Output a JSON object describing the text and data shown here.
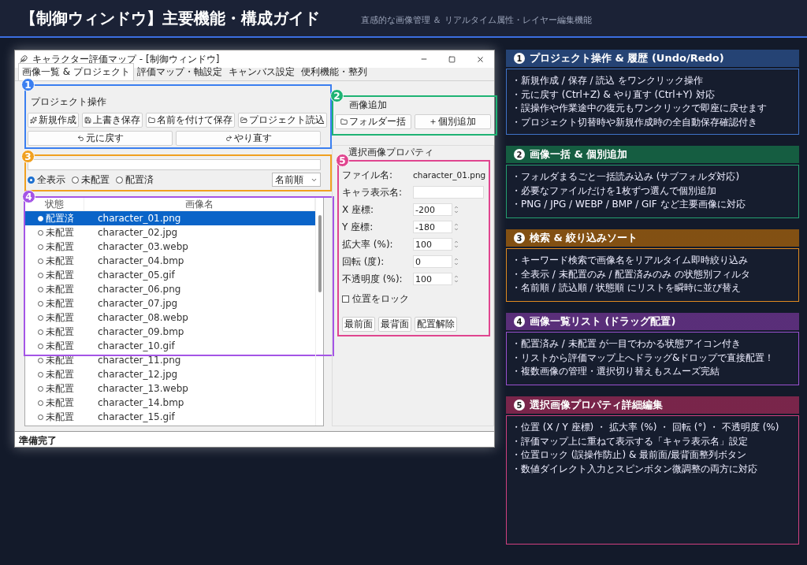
{
  "header": {
    "title": "【制御ウィンドウ】主要機能・構成ガイド",
    "subtitle": "直感的な画像管理 ＆ リアルタイム属性・レイヤー編集機能"
  },
  "window": {
    "title": "キャラクター評価マップ - [制御ウィンドウ]",
    "tabs": [
      {
        "label": "画像一覧 & プロジェクト",
        "selected": true
      },
      {
        "label": "評価マップ・軸設定",
        "selected": false
      },
      {
        "label": "キャンバス設定",
        "selected": false
      },
      {
        "label": "便利機能・整列",
        "selected": false
      }
    ],
    "project_group": {
      "title": "プロジェクト操作",
      "buttons": [
        "新規作成",
        "上書き保存",
        "名前を付けて保存",
        "プロジェクト読込"
      ],
      "history_buttons": [
        "元に戻す",
        "やり直す"
      ]
    },
    "add_group": {
      "title": "画像追加",
      "buttons": [
        "フォルダー括",
        "個別追加"
      ]
    },
    "filter": {
      "options": [
        {
          "label": "全表示",
          "selected": true
        },
        {
          "label": "未配置",
          "selected": false
        },
        {
          "label": "配置済",
          "selected": false
        }
      ],
      "sort": "名前順"
    },
    "list": {
      "columns": [
        "状態",
        "画像名"
      ],
      "rows": [
        {
          "status": "配置済",
          "file": "character_01.png",
          "placed": true,
          "selected": true
        },
        {
          "status": "未配置",
          "file": "character_02.jpg",
          "placed": false,
          "selected": false
        },
        {
          "status": "未配置",
          "file": "character_03.webp",
          "placed": false,
          "selected": false
        },
        {
          "status": "未配置",
          "file": "character_04.bmp",
          "placed": false,
          "selected": false
        },
        {
          "status": "未配置",
          "file": "character_05.gif",
          "placed": false,
          "selected": false
        },
        {
          "status": "未配置",
          "file": "character_06.png",
          "placed": false,
          "selected": false
        },
        {
          "status": "未配置",
          "file": "character_07.jpg",
          "placed": false,
          "selected": false
        },
        {
          "status": "未配置",
          "file": "character_08.webp",
          "placed": false,
          "selected": false
        },
        {
          "status": "未配置",
          "file": "character_09.bmp",
          "placed": false,
          "selected": false
        },
        {
          "status": "未配置",
          "file": "character_10.gif",
          "placed": false,
          "selected": false
        },
        {
          "status": "未配置",
          "file": "character_11.png",
          "placed": false,
          "selected": false
        },
        {
          "status": "未配置",
          "file": "character_12.jpg",
          "placed": false,
          "selected": false
        },
        {
          "status": "未配置",
          "file": "character_13.webp",
          "placed": false,
          "selected": false
        },
        {
          "status": "未配置",
          "file": "character_14.bmp",
          "placed": false,
          "selected": false
        },
        {
          "status": "未配置",
          "file": "character_15.gif",
          "placed": false,
          "selected": false
        }
      ]
    },
    "properties": {
      "title": "選択画像プロパティ",
      "fields": [
        {
          "kind": "text",
          "label": "ファイル名:",
          "value": "character_01.png"
        },
        {
          "kind": "input",
          "label": "キャラ表示名:"
        },
        {
          "kind": "spin",
          "label": "X 座標:",
          "value": "-200"
        },
        {
          "kind": "spin",
          "label": "Y 座標:",
          "value": "-180"
        },
        {
          "kind": "spin",
          "label": "拡大率 (%):",
          "value": "100"
        },
        {
          "kind": "spin",
          "label": "回転 (度):",
          "value": "0"
        },
        {
          "kind": "spin",
          "label": "不透明度 (%):",
          "value": "100"
        }
      ],
      "lock": {
        "label": "位置をロック",
        "checked": false
      },
      "buttons": [
        "最前面",
        "最背面",
        "配置解除"
      ]
    },
    "status_bar": "準備完了"
  },
  "annotations": [
    {
      "number": "1",
      "color": "#3b7ff0"
    },
    {
      "number": "2",
      "color": "#1fb374"
    },
    {
      "number": "3",
      "color": "#f0a020"
    },
    {
      "number": "5",
      "color": "#e0458f"
    },
    {
      "number": "4",
      "color": "#a455e6"
    }
  ],
  "cards": [
    {
      "number": "1",
      "title": "プロジェクト操作 & 履歴 (Undo/Redo)",
      "color": "#3f73c8",
      "items": [
        "・新規作成 / 保存 / 読込 をワンクリック操作",
        "・元に戻す (Ctrl+Z) & やり直す (Ctrl+Y) 対応",
        "・誤操作や作業途中の復元もワンクリックで即座に戻せます",
        "・プロジェクト切替時や新規作成時の全自動保存確認付き"
      ]
    },
    {
      "number": "2",
      "title": "画像一括 & 個別追加",
      "color": "#24a070",
      "items": [
        "・フォルダまるごと一括読み込み (サブフォルダ対応)",
        "・必要なファイルだけを1枚ずつ選んで個別追加",
        "・PNG / JPG / WEBP / BMP / GIF など主要画像に対応"
      ]
    },
    {
      "number": "3",
      "title": "検索 & 絞り込みソート",
      "color": "#e08a20",
      "items": [
        "・キーワード検索で画像名をリアルタイム即時絞り込み",
        "・全表示 / 未配置のみ / 配置済みのみ の状態別フィルタ",
        "・名前順 / 読込順 / 状態順 にリストを瞬時に並び替え"
      ]
    },
    {
      "number": "4",
      "title": "画像一覧リスト (ドラッグ配置)",
      "color": "#9a50d0",
      "items": [
        "・配置済み / 未配置 が一目でわかる状態アイコン付き",
        "・リストから評価マップ上へドラッグ&ドロップで直接配置！",
        "・複数画像の管理・選択切り替えもスムーズ完結"
      ]
    },
    {
      "number": "5",
      "title": "選択画像プロパティ詳細編集",
      "color": "#d04080",
      "items": [
        "・位置 (X / Y 座標) ・ 拡大率 (%) ・ 回転 (°) ・ 不透明度 (%)",
        "・評価マップ上に重ねて表示する「キャラ表示名」設定",
        "・位置ロック (誤操作防止) & 最前面/最背面整列ボタン",
        "・数値ダイレクト入力とスピンボタン微調整の両方に対応"
      ]
    }
  ]
}
